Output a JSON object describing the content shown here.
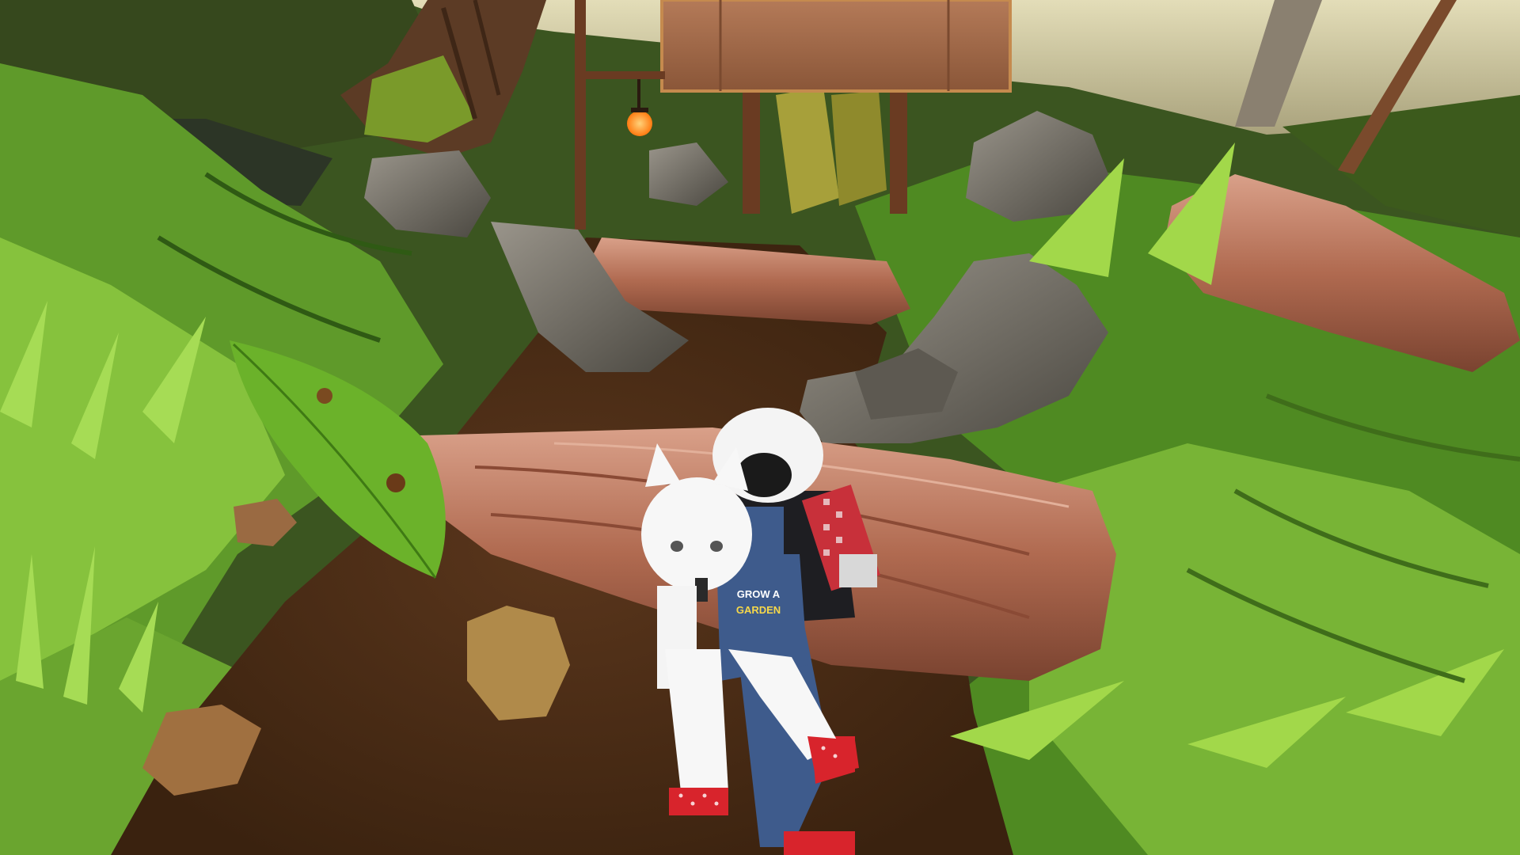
{
  "scene": {
    "type": "3d-game-viewport",
    "visible_hud": false,
    "sign": {
      "text": ""
    },
    "character": {
      "overalls_logo_line1": "GROW A",
      "overalls_logo_line2": "GARDEN"
    },
    "colors": {
      "sky_water": "#cfc9a4",
      "grass_light": "#7fbf3a",
      "grass_dark": "#2f5a14",
      "dirt_path": "#4a2d17",
      "log_bark": "#b06a50",
      "rock": "#6e6a62",
      "sign_wood": "#a06a4b",
      "post_wood": "#6a3b22",
      "lantern_glow": "#ff9a2a",
      "hair_white": "#f4f4f4",
      "overalls_blue": "#3e5b8c",
      "gingham_red": "#c8303a",
      "shoe_red": "#d8242c"
    }
  }
}
